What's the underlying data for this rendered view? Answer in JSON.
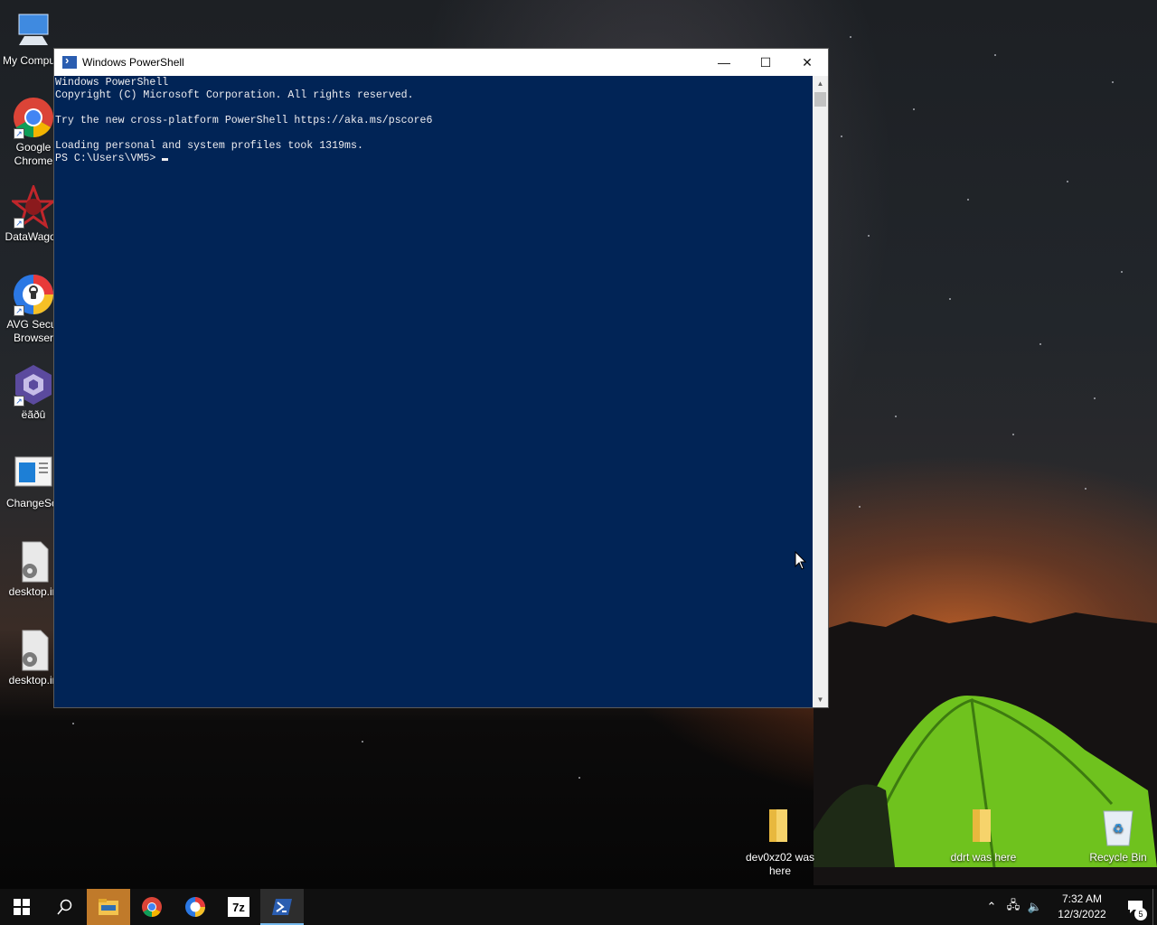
{
  "desktop": {
    "left_icons": [
      {
        "label": "My Compute",
        "icon": "computer-icon"
      },
      {
        "label": "Google Chrome",
        "icon": "chrome-icon"
      },
      {
        "label": "DataWagon",
        "icon": "datawagon-icon"
      },
      {
        "label": "AVG Secur Browser",
        "icon": "avg-browser-icon"
      },
      {
        "label": "ëãðû",
        "icon": "gamecube-icon"
      },
      {
        "label": "ChangeScr",
        "icon": "window-icon"
      },
      {
        "label": "desktop.in",
        "icon": "settings-file-icon"
      },
      {
        "label": "desktop.in",
        "icon": "settings-file-icon"
      }
    ],
    "bottom_icons": [
      {
        "label": "dev0xz02 was here",
        "icon": "folder-icon"
      },
      {
        "label": "ddrt was here",
        "icon": "folder-icon"
      },
      {
        "label": "Recycle Bin",
        "icon": "recycle-bin-icon"
      }
    ]
  },
  "window": {
    "title": "Windows PowerShell",
    "minimize": "—",
    "maximize": "☐",
    "close": "✕",
    "console_lines": [
      "Windows PowerShell",
      "Copyright (C) Microsoft Corporation. All rights reserved.",
      "",
      "Try the new cross-platform PowerShell https://aka.ms/pscore6",
      "",
      "Loading personal and system profiles took 1319ms."
    ],
    "prompt": "PS C:\\Users\\VM5> "
  },
  "taskbar": {
    "apps": [
      "start-icon",
      "search-icon",
      "file-explorer-icon",
      "chrome-icon",
      "avg-browser-icon",
      "7zip-icon",
      "powershell-icon"
    ],
    "clock_time": "7:32 AM",
    "clock_date": "12/3/2022",
    "notification_count": "5"
  },
  "colors": {
    "console_bg": "#012456",
    "console_fg": "#eeedf0",
    "taskbar_bg": "#101010"
  }
}
